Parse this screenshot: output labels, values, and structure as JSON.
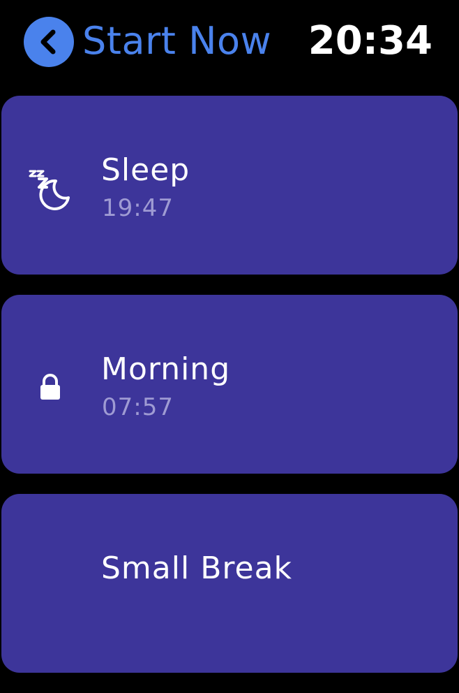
{
  "colors": {
    "background": "#000000",
    "accent": "#4a82ec",
    "card": "#3d359a",
    "secondary_text": "#9f9bd3",
    "primary_text": "#ffffff"
  },
  "header": {
    "back_icon": "chevron-left-icon",
    "title": "Start Now",
    "clock": "20:34"
  },
  "items": [
    {
      "icon": "sleep-moon-icon",
      "name": "Sleep",
      "time": "19:47"
    },
    {
      "icon": "lock-icon",
      "name": "Morning",
      "time": "07:57"
    },
    {
      "icon": "",
      "name": "Small Break",
      "time": ""
    }
  ]
}
